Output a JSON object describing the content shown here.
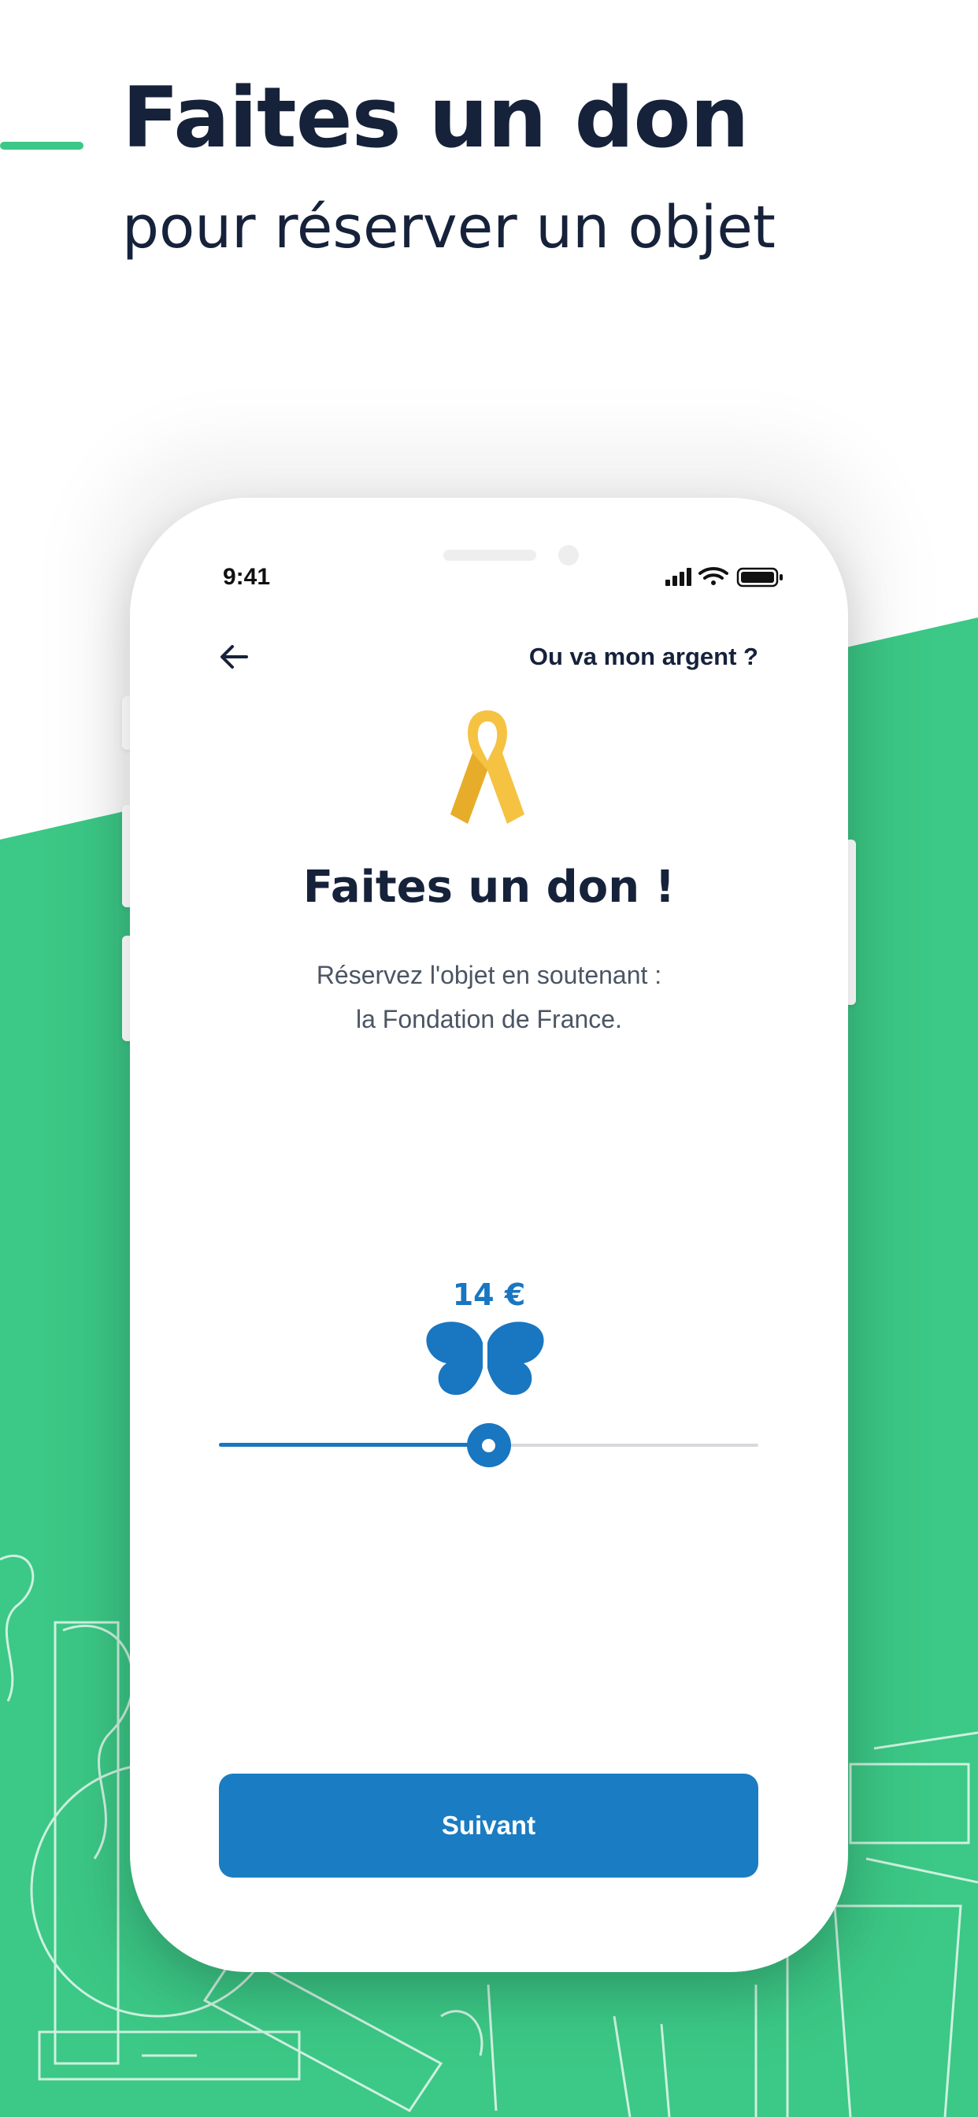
{
  "marketing": {
    "headline": "Faites un don",
    "subheadline": "pour réserver un objet"
  },
  "colors": {
    "brand_green": "#3cc886",
    "primary_blue": "#1a7cc2",
    "text_dark": "#16223a",
    "ribbon_gold": "#f5c242"
  },
  "status_bar": {
    "time": "9:41",
    "icons": [
      "signal-icon",
      "wifi-icon",
      "battery-icon"
    ]
  },
  "header": {
    "back_icon": "arrow-left-icon",
    "help_link": "Ou va mon argent ?"
  },
  "donation": {
    "icon": "awareness-ribbon-icon",
    "title": "Faites un don !",
    "description_line1": "Réservez l'objet en soutenant :",
    "description_line2": "la Fondation de France.",
    "amount_label": "14 €",
    "amount_icon": "butterfly-icon",
    "slider_level": 0.5
  },
  "footer": {
    "next_button": "Suivant"
  }
}
